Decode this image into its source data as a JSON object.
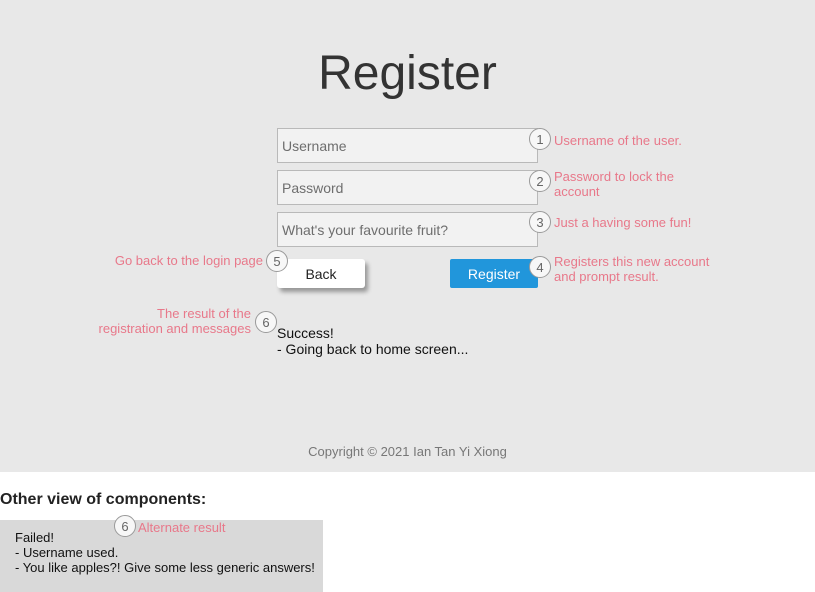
{
  "page": {
    "title": "Register",
    "footer": "Copyright © 2021 Ian Tan Yi Xiong"
  },
  "form": {
    "username_placeholder": "Username",
    "password_placeholder": "Password",
    "fruit_placeholder": "What's your favourite fruit?",
    "back_label": "Back",
    "register_label": "Register"
  },
  "result": {
    "lines": [
      "Success!",
      "- Going back to home screen..."
    ]
  },
  "annotations": {
    "badge_1": "1",
    "badge_2": "2",
    "badge_3": "3",
    "badge_4": "4",
    "badge_5": "5",
    "badge_6": "6",
    "badge_6_alt": "6",
    "note_1": "Username of the user.",
    "note_2_line1": "Password to lock the",
    "note_2_line2": "account",
    "note_3": "Just a having some fun!",
    "note_4_line1": "Registers this new account",
    "note_4_line2": "and prompt result.",
    "note_5": "Go back to the login page",
    "note_6_line1": "The result of the",
    "note_6_line2": "registration and messages",
    "note_6_alt": "Alternate result"
  },
  "other_view": {
    "heading": "Other view of components:",
    "alt_lines": [
      "Failed!",
      "- Username used.",
      "- You like apples?! Give some less generic answers!"
    ]
  },
  "colors": {
    "panel_bg": "#e8e8e8",
    "register_button": "#2196db",
    "annotation": "#e8788a"
  }
}
